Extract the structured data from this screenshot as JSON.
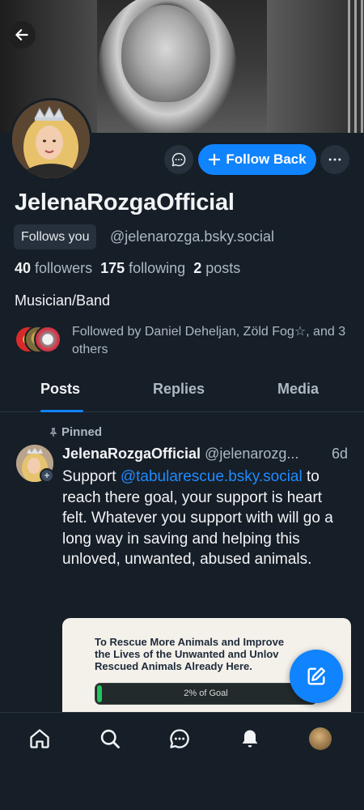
{
  "profile": {
    "display_name": "JelenaRozgaOfficial",
    "follows_you_label": "Follows you",
    "handle": "@jelenarozga.bsky.social",
    "followers_count": "40",
    "followers_label": "followers",
    "following_count": "175",
    "following_label": "following",
    "posts_count": "2",
    "posts_label": "posts",
    "bio": "Musician/Band",
    "followed_by": "Followed by Daniel Deheljan, Zöld Fog☆, and 3 others"
  },
  "actions": {
    "follow_back_label": "Follow Back",
    "back_icon": "arrow-left-icon",
    "message_icon": "chat-bubble-icon",
    "more_icon": "ellipsis-icon"
  },
  "tabs": [
    {
      "label": "Posts",
      "active": true
    },
    {
      "label": "Replies",
      "active": false
    },
    {
      "label": "Media",
      "active": false
    }
  ],
  "post": {
    "pinned_label": "Pinned",
    "author_name": "JelenaRozgaOfficial",
    "author_handle": "@jelenarozg...",
    "time": "6d",
    "text_before_mention": "Support ",
    "mention": "@tabularescue.bsky.social",
    "text_after_mention": " to reach there goal, your support is heart felt. Whatever you support with will go a long way in saving and helping this unloved, unwanted, abused animals.",
    "embed": {
      "headline": "To Rescue More Animals and Improve the Lives of the Unwanted and Unlov... Rescued Animals Already Here.",
      "headline_line1": "To Rescue More Animals and Improve",
      "headline_line2": "the Lives of the Unwanted and Unlov",
      "headline_line3": "Rescued Animals Already Here.",
      "progress_label": "2% of Goal",
      "progress": 0.02
    }
  },
  "bottom_nav": [
    {
      "name": "home",
      "icon": "home-icon"
    },
    {
      "name": "search",
      "icon": "search-icon"
    },
    {
      "name": "messages",
      "icon": "chat-bubble-icon"
    },
    {
      "name": "notifications",
      "icon": "bell-icon"
    },
    {
      "name": "profile",
      "icon": "avatar"
    }
  ],
  "colors": {
    "background": "#161e27",
    "accent": "#1083fe",
    "muted_text": "#aeb8c3",
    "surface": "#26313d"
  }
}
